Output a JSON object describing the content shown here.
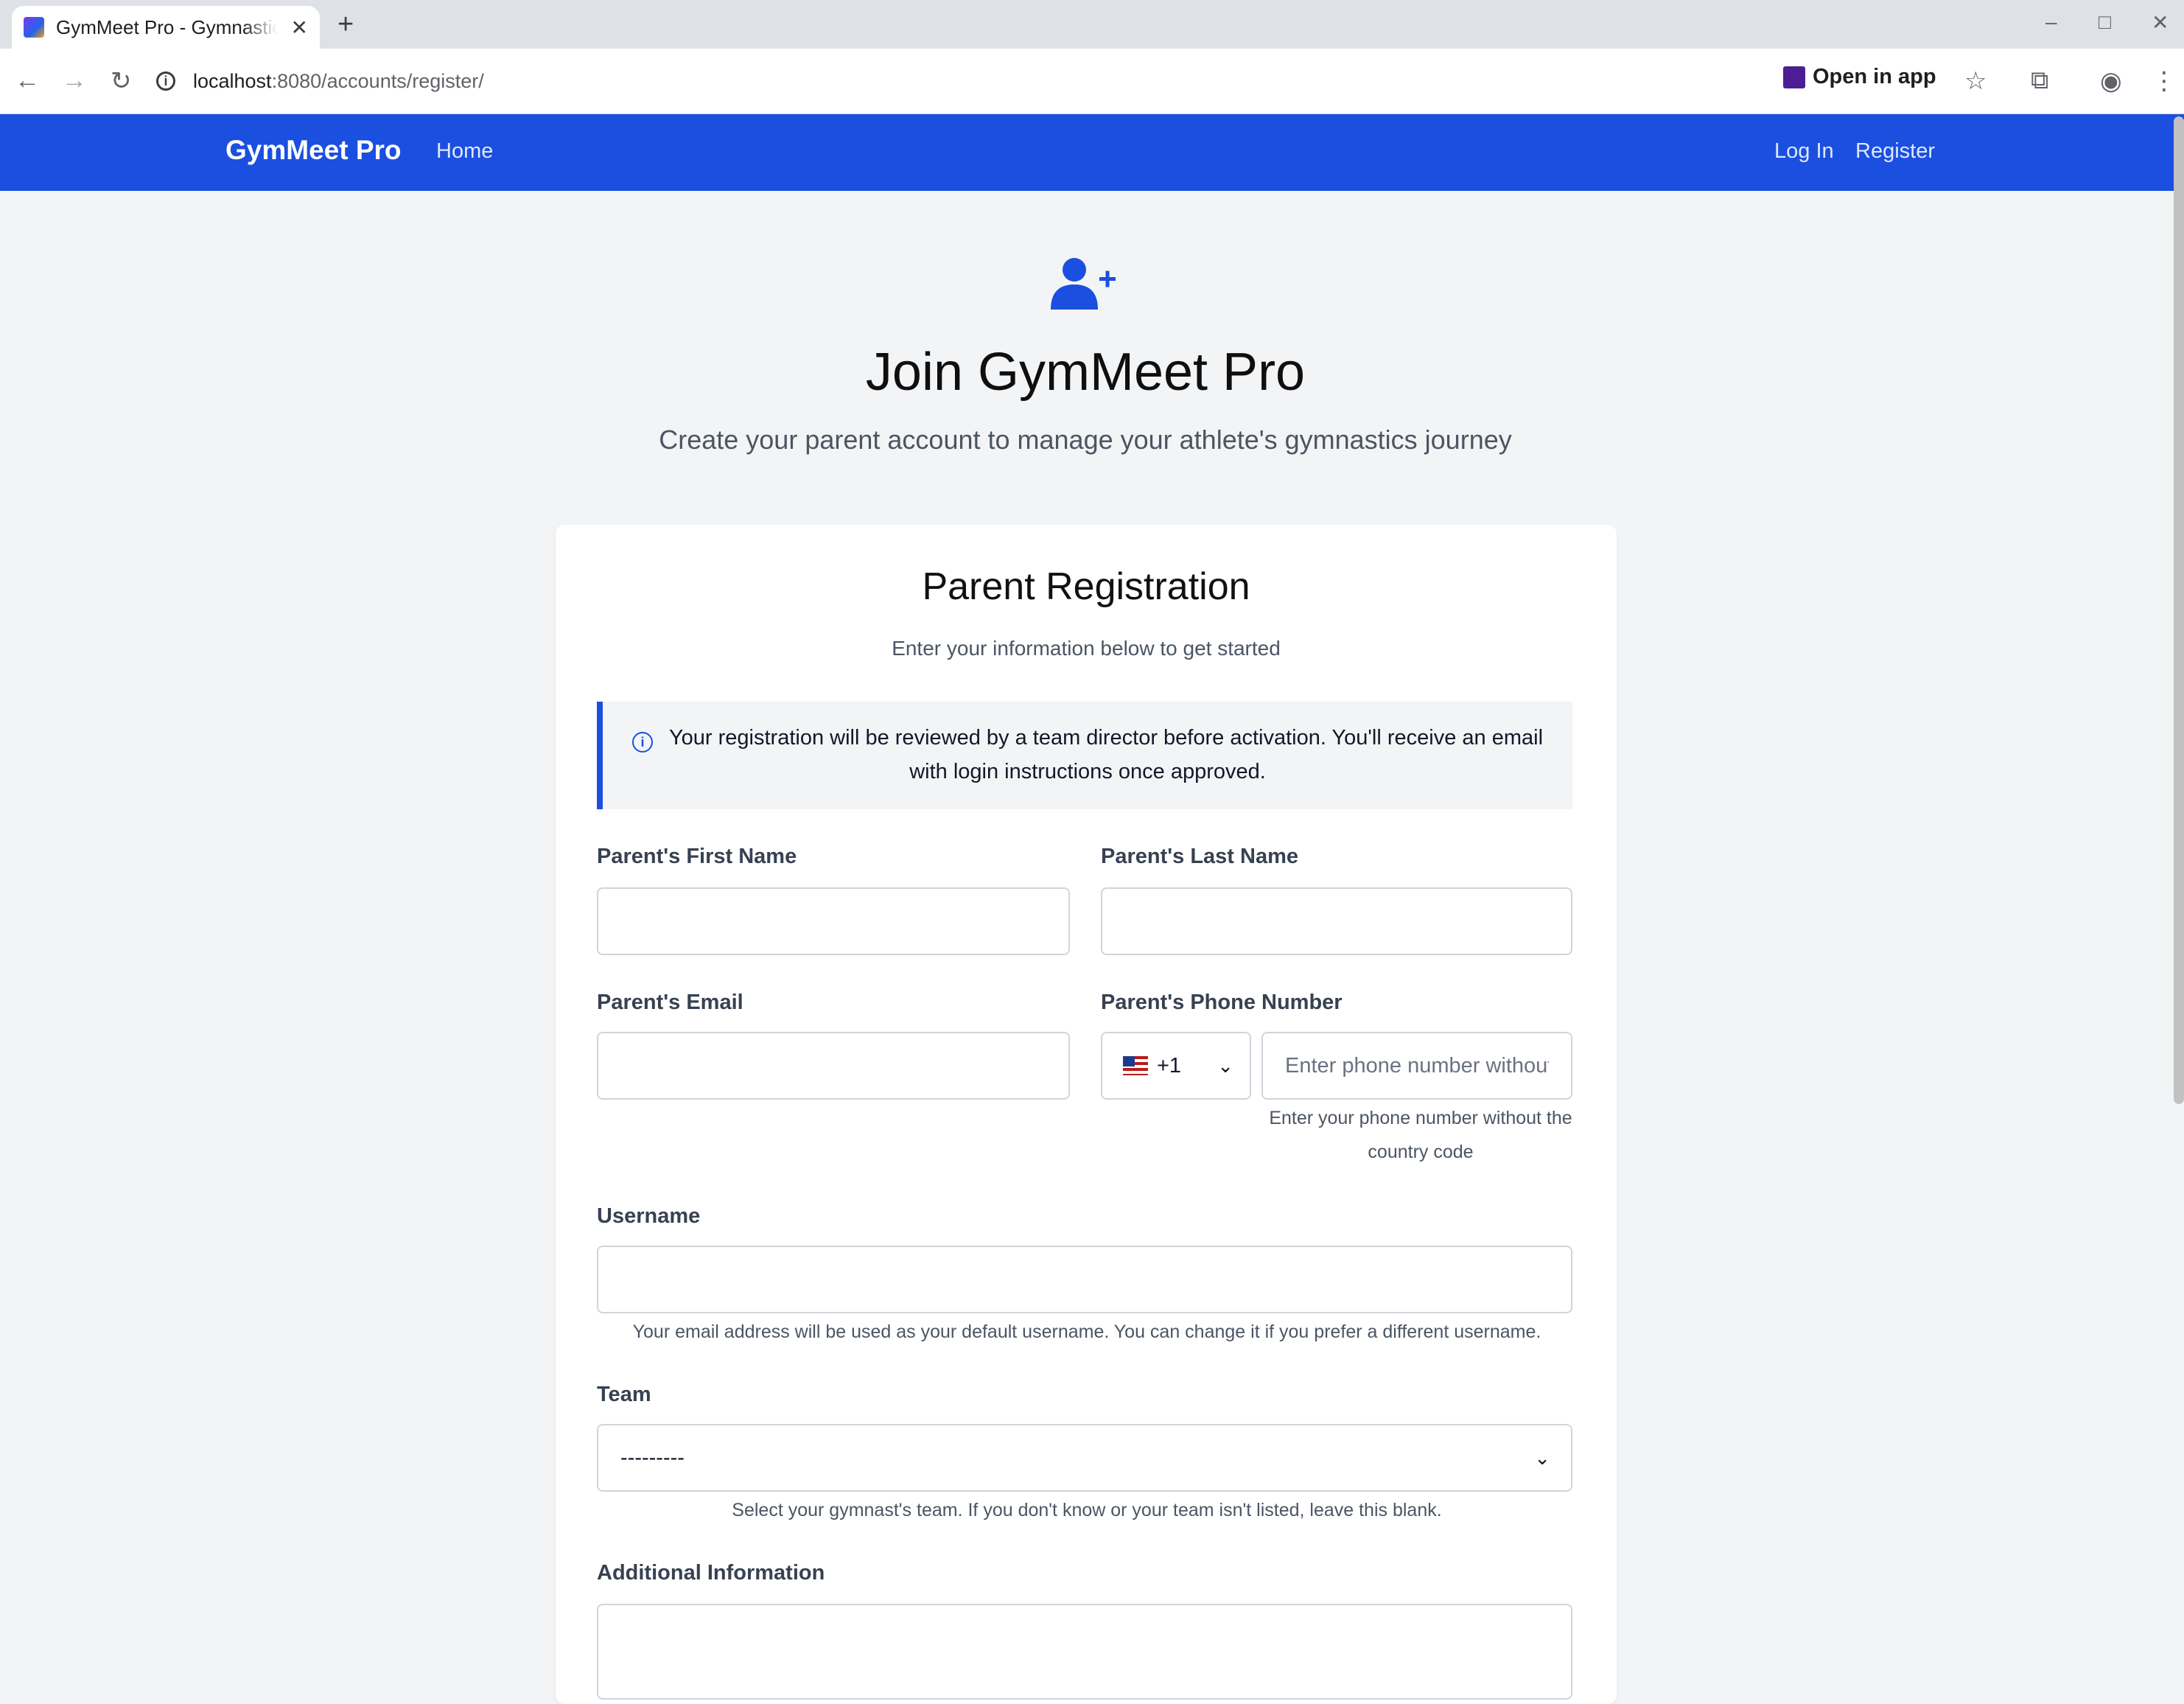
{
  "browser": {
    "tab_title": "GymMeet Pro - Gymnastics",
    "url_host": "localhost",
    "url_rest": ":8080/accounts/register/",
    "open_in_app": "Open in app"
  },
  "nav": {
    "brand": "GymMeet Pro",
    "home": "Home",
    "login": "Log In",
    "register": "Register",
    "color": "#1a4fe0"
  },
  "hero": {
    "title": "Join GymMeet Pro",
    "subtitle": "Create your parent account to manage your athlete's gymnastics journey"
  },
  "form": {
    "title": "Parent Registration",
    "subtitle": "Enter your information below to get started",
    "notice": "Your registration will be reviewed by a team director before activation. You'll receive an email with login instructions once approved.",
    "first_name_label": "Parent's First Name",
    "first_name_value": "",
    "last_name_label": "Parent's Last Name",
    "last_name_value": "",
    "email_label": "Parent's Email",
    "email_value": "",
    "phone_label": "Parent's Phone Number",
    "country_code": "+1",
    "phone_placeholder": "Enter phone number without country code",
    "phone_help": "Enter your phone number without the country code",
    "username_label": "Username",
    "username_value": "",
    "username_help": "Your email address will be used as your default username. You can change it if you prefer a different username.",
    "team_label": "Team",
    "team_selected": "---------",
    "team_help": "Select your gymnast's team. If you don't know or your team isn't listed, leave this blank.",
    "additional_label": "Additional Information"
  }
}
